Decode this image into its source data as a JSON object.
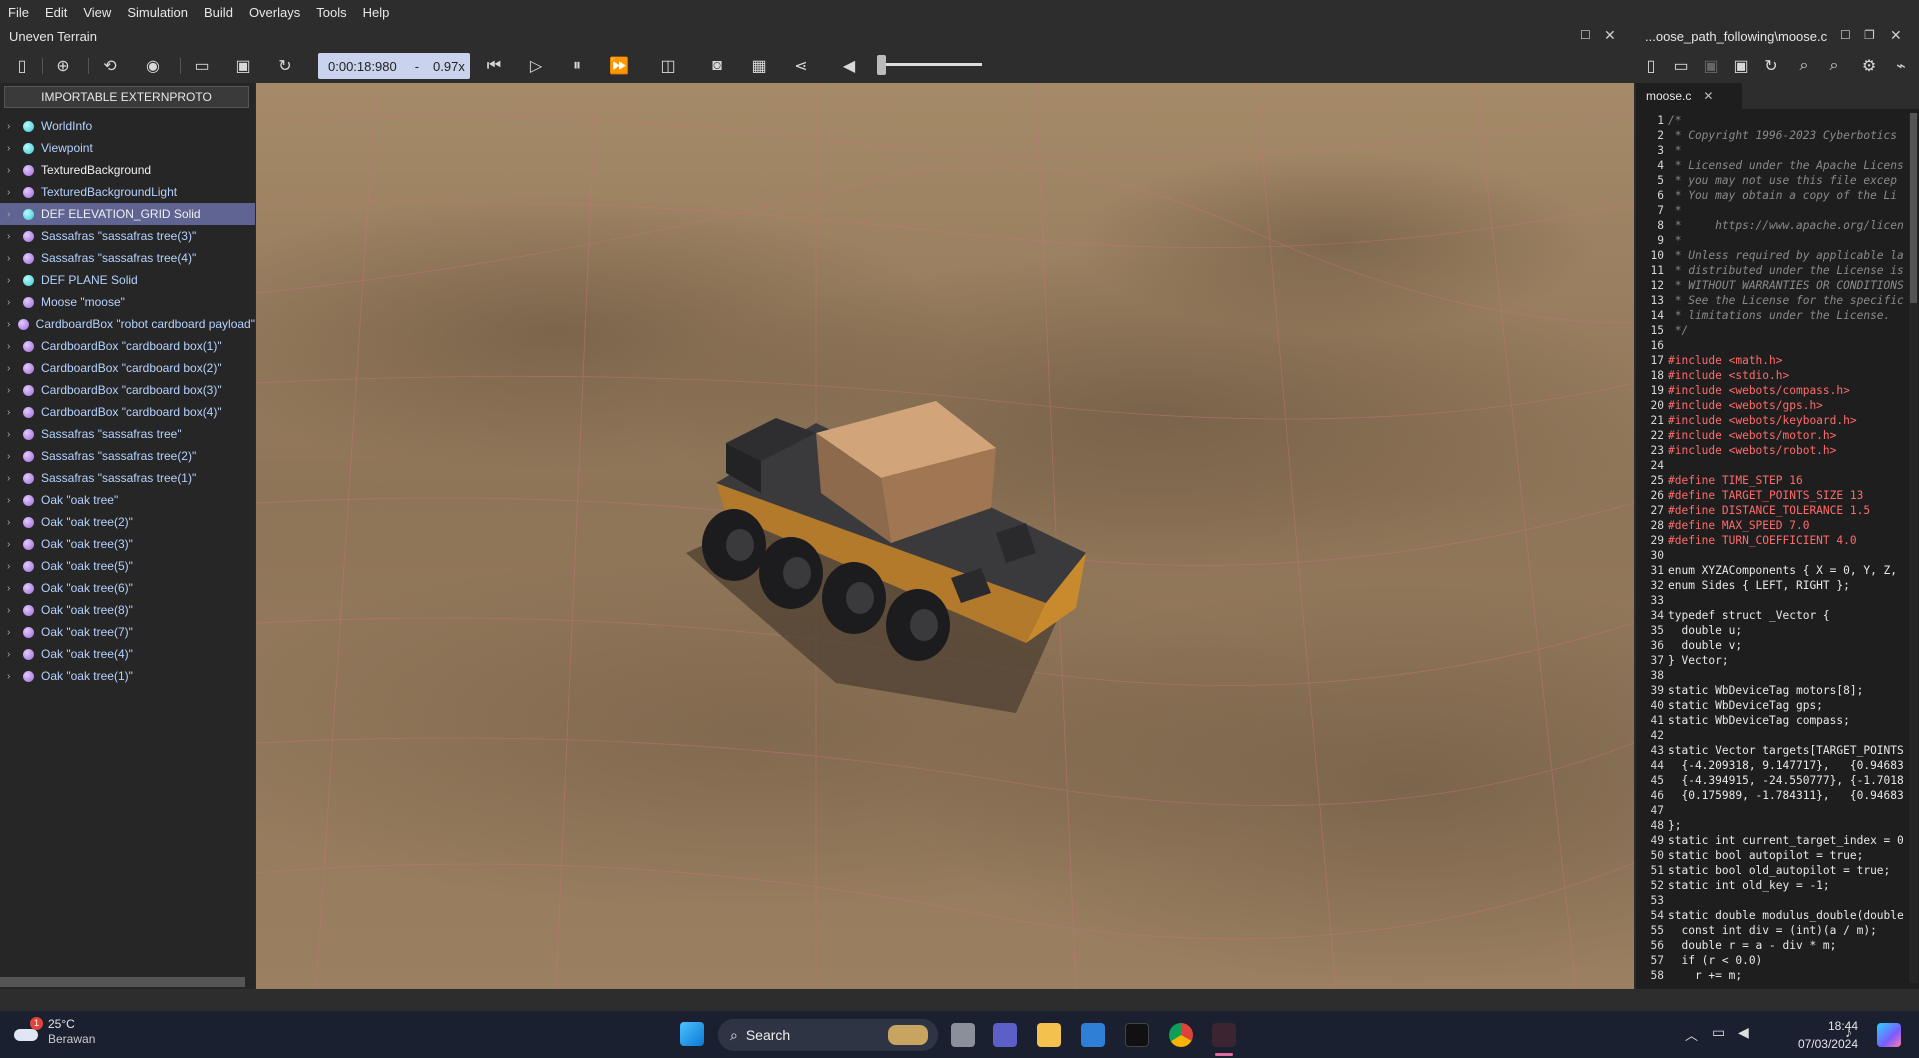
{
  "menu": [
    "File",
    "Edit",
    "View",
    "Simulation",
    "Build",
    "Overlays",
    "Tools",
    "Help"
  ],
  "window": {
    "title_left": "Uneven Terrain",
    "title_right": "...oose_path_following\\moose.c"
  },
  "toolbar": {
    "time": "0:00:18:980",
    "separator": "-",
    "speed": "0.97x"
  },
  "scene_tree": {
    "importable_button": "IMPORTABLE EXTERNPROTO",
    "items": [
      {
        "label": "WorldInfo",
        "dot": "cyan",
        "style": "blue"
      },
      {
        "label": "Viewpoint",
        "dot": "cyan",
        "style": "blue"
      },
      {
        "label": "TexturedBackground",
        "dot": "purple",
        "style": "white"
      },
      {
        "label": "TexturedBackgroundLight",
        "dot": "purple",
        "style": "blue"
      },
      {
        "label": "DEF ELEVATION_GRID Solid",
        "dot": "cyan",
        "style": "white",
        "selected": true
      },
      {
        "label": "Sassafras \"sassafras tree(3)\"",
        "dot": "purple",
        "style": "blue"
      },
      {
        "label": "Sassafras \"sassafras tree(4)\"",
        "dot": "purple",
        "style": "blue"
      },
      {
        "label": "DEF PLANE Solid",
        "dot": "cyan",
        "style": "blue"
      },
      {
        "label": "Moose \"moose\"",
        "dot": "purple",
        "style": "blue"
      },
      {
        "label": "CardboardBox \"robot cardboard payload\"",
        "dot": "purple",
        "style": "blue"
      },
      {
        "label": "CardboardBox \"cardboard box(1)\"",
        "dot": "purple",
        "style": "blue"
      },
      {
        "label": "CardboardBox \"cardboard box(2)\"",
        "dot": "purple",
        "style": "blue"
      },
      {
        "label": "CardboardBox \"cardboard box(3)\"",
        "dot": "purple",
        "style": "blue"
      },
      {
        "label": "CardboardBox \"cardboard box(4)\"",
        "dot": "purple",
        "style": "blue"
      },
      {
        "label": "Sassafras \"sassafras tree\"",
        "dot": "purple",
        "style": "blue"
      },
      {
        "label": "Sassafras \"sassafras tree(2)\"",
        "dot": "purple",
        "style": "blue"
      },
      {
        "label": "Sassafras \"sassafras tree(1)\"",
        "dot": "purple",
        "style": "blue"
      },
      {
        "label": "Oak \"oak tree\"",
        "dot": "purple",
        "style": "blue"
      },
      {
        "label": "Oak \"oak tree(2)\"",
        "dot": "purple",
        "style": "blue"
      },
      {
        "label": "Oak \"oak tree(3)\"",
        "dot": "purple",
        "style": "blue"
      },
      {
        "label": "Oak \"oak tree(5)\"",
        "dot": "purple",
        "style": "blue"
      },
      {
        "label": "Oak \"oak tree(6)\"",
        "dot": "purple",
        "style": "blue"
      },
      {
        "label": "Oak \"oak tree(8)\"",
        "dot": "purple",
        "style": "blue"
      },
      {
        "label": "Oak \"oak tree(7)\"",
        "dot": "purple",
        "style": "blue"
      },
      {
        "label": "Oak \"oak tree(4)\"",
        "dot": "purple",
        "style": "blue"
      },
      {
        "label": "Oak \"oak tree(1)\"",
        "dot": "purple",
        "style": "blue"
      }
    ]
  },
  "editor": {
    "tab": "moose.c",
    "lines": [
      {
        "n": "1",
        "t": "/*",
        "c": "comment"
      },
      {
        "n": "2",
        "t": " * Copyright 1996-2023 Cyberbotics",
        "c": "comment"
      },
      {
        "n": "3",
        "t": " *",
        "c": "comment"
      },
      {
        "n": "4",
        "t": " * Licensed under the Apache Licens",
        "c": "comment"
      },
      {
        "n": "5",
        "t": " * you may not use this file excep",
        "c": "comment"
      },
      {
        "n": "6",
        "t": " * You may obtain a copy of the Li",
        "c": "comment"
      },
      {
        "n": "7",
        "t": " *",
        "c": "comment"
      },
      {
        "n": "8",
        "t": " *     https://www.apache.org/licen",
        "c": "comment"
      },
      {
        "n": "9",
        "t": " *",
        "c": "comment"
      },
      {
        "n": "10",
        "t": " * Unless required by applicable la",
        "c": "comment"
      },
      {
        "n": "11",
        "t": " * distributed under the License is",
        "c": "comment"
      },
      {
        "n": "12",
        "t": " * WITHOUT WARRANTIES OR CONDITIONS",
        "c": "comment"
      },
      {
        "n": "13",
        "t": " * See the License for the specific",
        "c": "comment"
      },
      {
        "n": "14",
        "t": " * limitations under the License.",
        "c": "comment"
      },
      {
        "n": "15",
        "t": " */",
        "c": "comment"
      },
      {
        "n": "16",
        "t": "",
        "c": "plain"
      },
      {
        "n": "17",
        "t": "#include <math.h>",
        "c": "pre"
      },
      {
        "n": "18",
        "t": "#include <stdio.h>",
        "c": "pre"
      },
      {
        "n": "19",
        "t": "#include <webots/compass.h>",
        "c": "pre"
      },
      {
        "n": "20",
        "t": "#include <webots/gps.h>",
        "c": "pre"
      },
      {
        "n": "21",
        "t": "#include <webots/keyboard.h>",
        "c": "pre"
      },
      {
        "n": "22",
        "t": "#include <webots/motor.h>",
        "c": "pre"
      },
      {
        "n": "23",
        "t": "#include <webots/robot.h>",
        "c": "pre"
      },
      {
        "n": "24",
        "t": "",
        "c": "plain"
      },
      {
        "n": "25",
        "t": "#define TIME_STEP 16",
        "c": "pre"
      },
      {
        "n": "26",
        "t": "#define TARGET_POINTS_SIZE 13",
        "c": "pre"
      },
      {
        "n": "27",
        "t": "#define DISTANCE_TOLERANCE 1.5",
        "c": "pre"
      },
      {
        "n": "28",
        "t": "#define MAX_SPEED 7.0",
        "c": "pre"
      },
      {
        "n": "29",
        "t": "#define TURN_COEFFICIENT 4.0",
        "c": "pre"
      },
      {
        "n": "30",
        "t": "",
        "c": "plain"
      },
      {
        "n": "31",
        "t": "enum XYZAComponents { X = 0, Y, Z,",
        "c": "plain"
      },
      {
        "n": "32",
        "t": "enum Sides { LEFT, RIGHT };",
        "c": "plain"
      },
      {
        "n": "33",
        "t": "",
        "c": "plain"
      },
      {
        "n": "34",
        "t": "typedef struct _Vector {",
        "c": "plain"
      },
      {
        "n": "35",
        "t": "  double u;",
        "c": "plain"
      },
      {
        "n": "36",
        "t": "  double v;",
        "c": "plain"
      },
      {
        "n": "37",
        "t": "} Vector;",
        "c": "plain"
      },
      {
        "n": "38",
        "t": "",
        "c": "plain"
      },
      {
        "n": "39",
        "t": "static WbDeviceTag motors[8];",
        "c": "plain"
      },
      {
        "n": "40",
        "t": "static WbDeviceTag gps;",
        "c": "plain"
      },
      {
        "n": "41",
        "t": "static WbDeviceTag compass;",
        "c": "plain"
      },
      {
        "n": "42",
        "t": "",
        "c": "plain"
      },
      {
        "n": "43",
        "t": "static Vector targets[TARGET_POINTS",
        "c": "plain"
      },
      {
        "n": "44",
        "t": "  {-4.209318, 9.147717},   {0.94683",
        "c": "plain"
      },
      {
        "n": "45",
        "t": "  {-4.394915, -24.550777}, {-1.7018",
        "c": "plain"
      },
      {
        "n": "46",
        "t": "  {0.175989, -1.784311},   {0.94683",
        "c": "plain"
      },
      {
        "n": "47",
        "t": "",
        "c": "plain"
      },
      {
        "n": "48",
        "t": "};",
        "c": "plain"
      },
      {
        "n": "49",
        "t": "static int current_target_index = 0",
        "c": "plain"
      },
      {
        "n": "50",
        "t": "static bool autopilot = true;",
        "c": "plain"
      },
      {
        "n": "51",
        "t": "static bool old_autopilot = true;",
        "c": "plain"
      },
      {
        "n": "52",
        "t": "static int old_key = -1;",
        "c": "plain"
      },
      {
        "n": "53",
        "t": "",
        "c": "plain"
      },
      {
        "n": "54",
        "t": "static double modulus_double(double",
        "c": "plain"
      },
      {
        "n": "55",
        "t": "  const int div = (int)(a / m);",
        "c": "plain"
      },
      {
        "n": "56",
        "t": "  double r = a - div * m;",
        "c": "plain"
      },
      {
        "n": "57",
        "t": "  if (r < 0.0)",
        "c": "plain"
      },
      {
        "n": "58",
        "t": "    r += m;",
        "c": "plain"
      }
    ]
  },
  "taskbar": {
    "temp": "25°C",
    "weather": "Berawan",
    "badge": "1",
    "search": "Search",
    "time": "18:44",
    "date": "07/03/2024"
  },
  "colors": {
    "comment": "#8a8a8a",
    "pre": "#ff6b6b",
    "plain": "#e8e8e8",
    "selected_row": "#5f6492"
  }
}
